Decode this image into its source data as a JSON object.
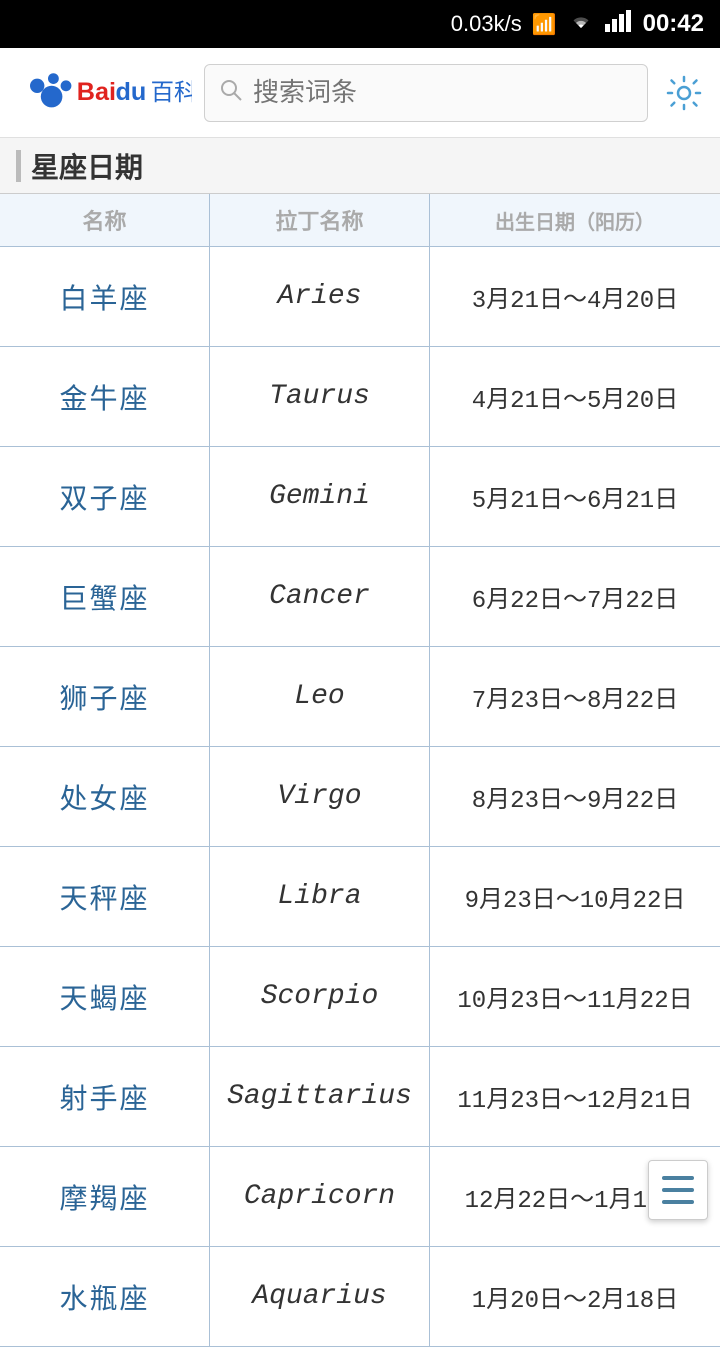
{
  "statusBar": {
    "speed": "0.03k/s",
    "time": "00:42"
  },
  "topBar": {
    "logoText": "百科",
    "searchPlaceholder": "搜索词条",
    "gearTitle": "设置"
  },
  "sectionHeader": {
    "title": "星座日期"
  },
  "columnHeaders": {
    "col1": "名称",
    "col2": "拉丁名称",
    "col3": "出生日期（阳历）"
  },
  "rows": [
    {
      "cn": "白羊座",
      "en": "Aries",
      "date": "3月21日～4月20日"
    },
    {
      "cn": "金牛座",
      "en": "Taurus",
      "date": "4月21日～5月20日"
    },
    {
      "cn": "双子座",
      "en": "Gemini",
      "date": "5月21日～6月21日"
    },
    {
      "cn": "巨蟹座",
      "en": "Cancer",
      "date": "6月22日～7月22日"
    },
    {
      "cn": "狮子座",
      "en": "Leo",
      "date": "7月23日～8月22日"
    },
    {
      "cn": "处女座",
      "en": "Virgo",
      "date": "8月23日～9月22日"
    },
    {
      "cn": "天秤座",
      "en": "Libra",
      "date": "9月23日～10月22日"
    },
    {
      "cn": "天蝎座",
      "en": "Scorpio",
      "date": "10月23日～11月22日"
    },
    {
      "cn": "射手座",
      "en": "Sagittarius",
      "date": "11月23日～12月21日"
    },
    {
      "cn": "摩羯座",
      "en": "Capricorn",
      "date": "12月22日～1月19日"
    },
    {
      "cn": "水瓶座",
      "en": "Aquarius",
      "date": "1月20日～2月18日"
    }
  ],
  "colors": {
    "accent": "#2a6496",
    "tableHeaderBg": "#f0f6fc",
    "border": "#aac0d6"
  }
}
